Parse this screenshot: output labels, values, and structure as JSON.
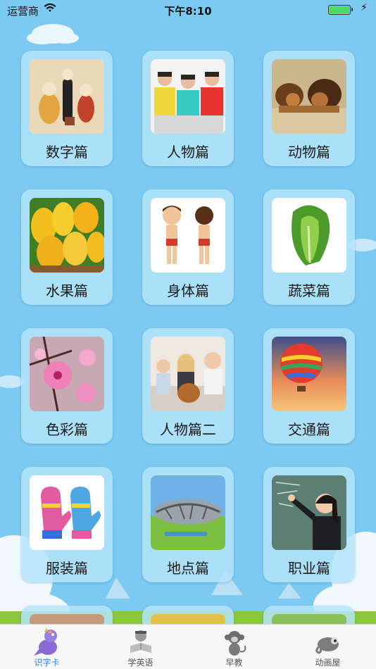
{
  "status_bar": {
    "carrier": "运营商",
    "time": "下午8:10"
  },
  "cards": [
    {
      "label": "数字篇",
      "icon": "numbers-monks-image"
    },
    {
      "label": "人物篇",
      "icon": "boys-image"
    },
    {
      "label": "动物篇",
      "icon": "lions-image"
    },
    {
      "label": "水果篇",
      "icon": "mangoes-image"
    },
    {
      "label": "身体篇",
      "icon": "body-boys-image"
    },
    {
      "label": "蔬菜篇",
      "icon": "lettuce-image"
    },
    {
      "label": "色彩篇",
      "icon": "blossom-image"
    },
    {
      "label": "人物篇二",
      "icon": "family-dog-image"
    },
    {
      "label": "交通篇",
      "icon": "hot-air-balloon-image"
    },
    {
      "label": "服装篇",
      "icon": "mittens-image"
    },
    {
      "label": "地点篇",
      "icon": "stadium-image"
    },
    {
      "label": "职业篇",
      "icon": "teacher-image"
    }
  ],
  "tabs": [
    {
      "label": "识字卡",
      "icon": "dinosaur-icon",
      "active": true
    },
    {
      "label": "学英语",
      "icon": "reading-kid-icon",
      "active": false
    },
    {
      "label": "早教",
      "icon": "monkey-icon",
      "active": false
    },
    {
      "label": "动画屋",
      "icon": "chameleon-icon",
      "active": false
    }
  ],
  "colors": {
    "background": "#7ccaf2",
    "tab_active": "#2f86e8",
    "battery": "#4cd964"
  }
}
